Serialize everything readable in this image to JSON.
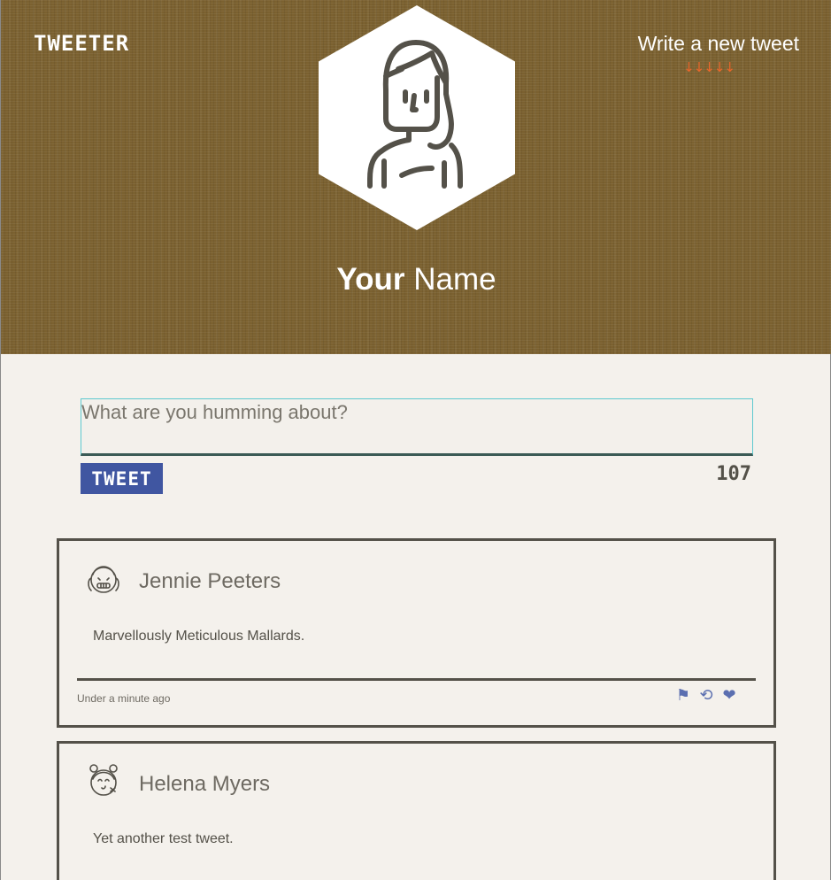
{
  "header": {
    "logo": "TWEETER",
    "compose_label": "Write a new tweet",
    "compose_arrows": "↓↓↓↓↓",
    "profile_first": "Your",
    "profile_last": " Name"
  },
  "composer": {
    "placeholder": "What are you humming about?",
    "value": "",
    "button_label": "TWEET",
    "counter": "107"
  },
  "tweets": [
    {
      "name": "Jennie Peeters",
      "body": "Marvellously Meticulous Mallards.",
      "time": "Under a minute ago",
      "actions": {
        "flag": "⚑",
        "retweet": "⟲",
        "like": "❤"
      }
    },
    {
      "name": "Helena Myers",
      "body": "Yet another test tweet."
    }
  ],
  "colors": {
    "header_bg": "#7b6130",
    "accent_blue": "#4056a1",
    "arrow_orange": "#e8662a",
    "text_dark": "#545149"
  }
}
